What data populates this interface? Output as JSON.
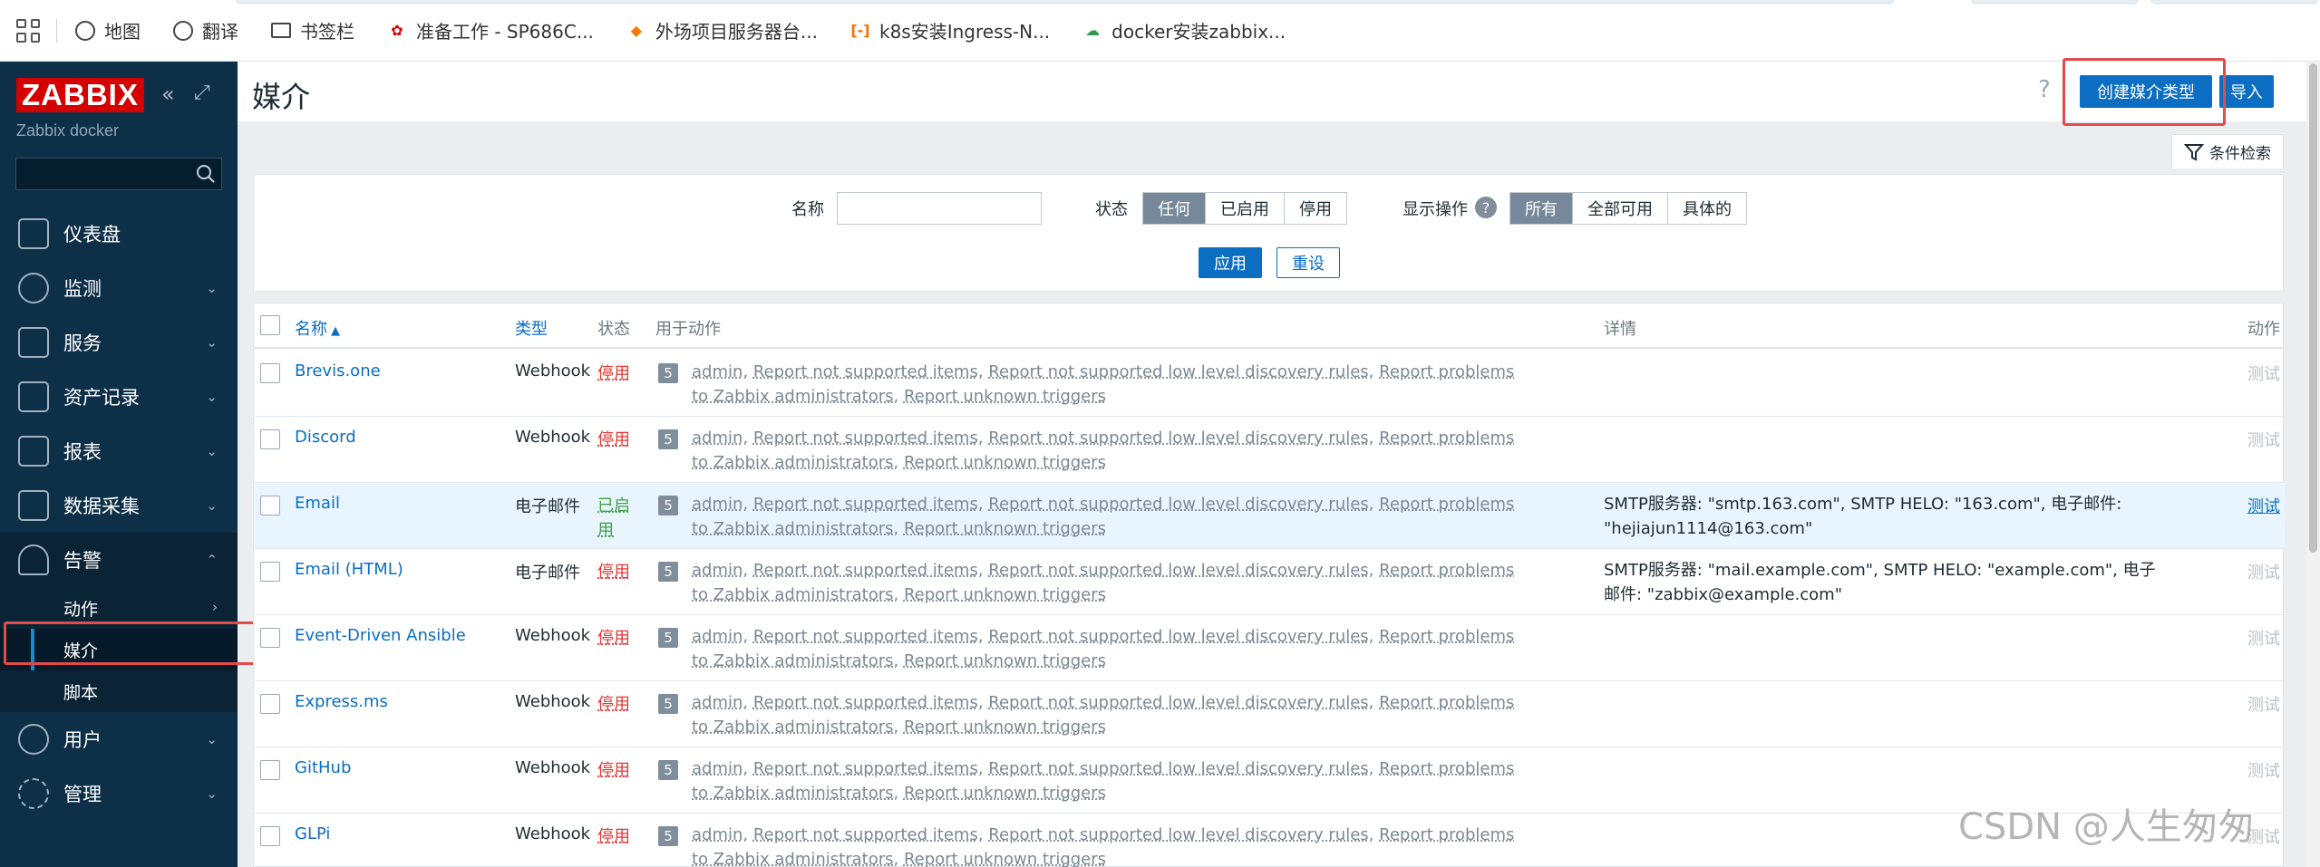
{
  "bookmarks": {
    "items": [
      {
        "label": "地图",
        "icon": "globe-icon"
      },
      {
        "label": "翻译",
        "icon": "globe-icon"
      },
      {
        "label": "书签栏",
        "icon": "folder-icon"
      },
      {
        "label": "准备工作 - SP686C...",
        "icon": "huawei-icon"
      },
      {
        "label": "外场项目服务器台...",
        "icon": "diamond-icon"
      },
      {
        "label": "k8s安装Ingress-N...",
        "icon": "bracket-icon"
      },
      {
        "label": "docker安装zabbix...",
        "icon": "cloud-icon"
      }
    ]
  },
  "sidebar": {
    "logo": "ZABBIX",
    "instance": "Zabbix docker",
    "collapse_icon": "«",
    "kiosk_icon": "⤢",
    "nav": [
      {
        "label": "仪表盘",
        "icon": "dashboard-icon"
      },
      {
        "label": "监测",
        "icon": "monitoring-icon"
      },
      {
        "label": "服务",
        "icon": "services-icon"
      },
      {
        "label": "资产记录",
        "icon": "inventory-icon"
      },
      {
        "label": "报表",
        "icon": "reports-icon"
      },
      {
        "label": "数据采集",
        "icon": "data-collection-icon"
      },
      {
        "label": "告警",
        "icon": "alerts-icon"
      }
    ],
    "alerts_sub": [
      {
        "label": "动作"
      },
      {
        "label": "媒介"
      },
      {
        "label": "脚本"
      }
    ],
    "nav_bottom": [
      {
        "label": "用户",
        "icon": "users-icon"
      },
      {
        "label": "管理",
        "icon": "gear-icon"
      }
    ]
  },
  "header": {
    "title": "媒介",
    "help": "?",
    "create_button": "创建媒介类型",
    "import_button": "导入"
  },
  "filter": {
    "tab_label": "条件检索",
    "name_label": "名称",
    "name_value": "",
    "status_label": "状态",
    "status_options": [
      "任何",
      "已启用",
      "停用"
    ],
    "status_selected": "任何",
    "actions_label": "显示操作",
    "actions_options": [
      "所有",
      "全部可用",
      "具体的"
    ],
    "actions_selected": "所有",
    "apply_button": "应用",
    "reset_button": "重设"
  },
  "table": {
    "columns": {
      "name": "名称",
      "sort_arrow": "▲",
      "type": "类型",
      "status": "状态",
      "used_in_actions": "用于动作",
      "details": "详情",
      "action": "动作"
    },
    "action_links": [
      "admin",
      "Report not supported items",
      "Report not supported low level discovery rules",
      "Report problems to Zabbix administrators",
      "Report unknown triggers"
    ],
    "rows": [
      {
        "name": "Brevis.one",
        "type": "Webhook",
        "status": "停用",
        "count": "5",
        "details": "",
        "test": "测试"
      },
      {
        "name": "Discord",
        "type": "Webhook",
        "status": "停用",
        "count": "5",
        "details": "",
        "test": "测试"
      },
      {
        "name": "Email",
        "type": "电子邮件",
        "status": "已启用",
        "count": "5",
        "details": "SMTP服务器: \"smtp.163.com\", SMTP HELO: \"163.com\", 电子邮件: \"hejiajun1114@163.com\"",
        "test": "测试"
      },
      {
        "name": "Email (HTML)",
        "type": "电子邮件",
        "status": "停用",
        "count": "5",
        "details": "SMTP服务器: \"mail.example.com\", SMTP HELO: \"example.com\", 电子邮件: \"zabbix@example.com\"",
        "test": "测试"
      },
      {
        "name": "Event-Driven Ansible",
        "type": "Webhook",
        "status": "停用",
        "count": "5",
        "details": "",
        "test": "测试"
      },
      {
        "name": "Express.ms",
        "type": "Webhook",
        "status": "停用",
        "count": "5",
        "details": "",
        "test": "测试"
      },
      {
        "name": "GitHub",
        "type": "Webhook",
        "status": "停用",
        "count": "5",
        "details": "",
        "test": "测试"
      },
      {
        "name": "GLPi",
        "type": "Webhook",
        "status": "停用",
        "count": "5",
        "details": "",
        "test": "测试"
      }
    ]
  },
  "watermark": "CSDN @人生匆匆",
  "colors": {
    "sidebar_bg": "#0e2f48",
    "primary": "#0b6ec3",
    "disabled_status": "#e33734",
    "enabled_status": "#429e47",
    "highlight_box": "#e24b4b"
  }
}
